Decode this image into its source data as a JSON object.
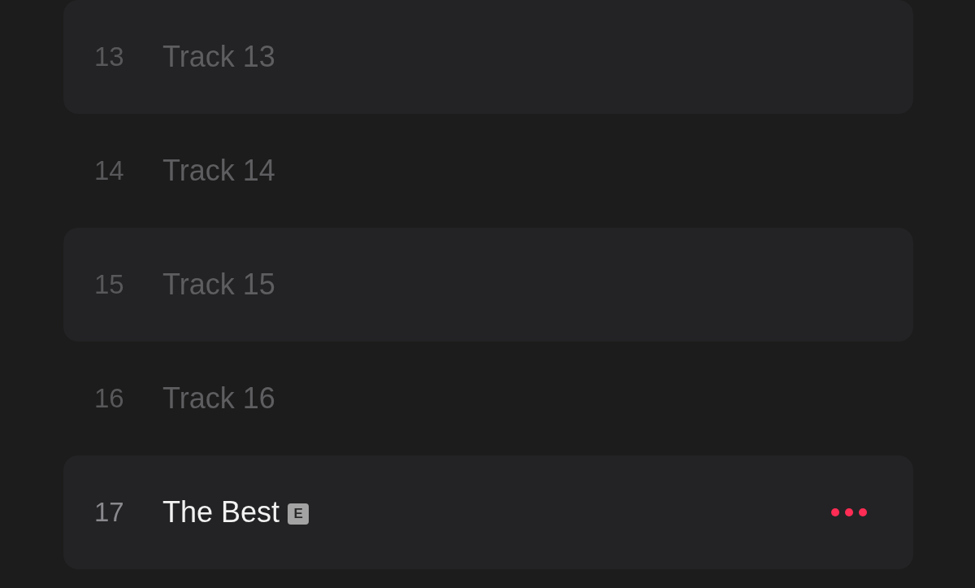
{
  "tracks": [
    {
      "number": "13",
      "title": "Track 13",
      "disabled": true
    },
    {
      "number": "14",
      "title": "Track 14",
      "disabled": true
    },
    {
      "number": "15",
      "title": "Track 15",
      "disabled": true
    },
    {
      "number": "16",
      "title": "Track 16",
      "disabled": true
    },
    {
      "number": "17",
      "title": "The Best",
      "badge": "E",
      "disabled": false
    }
  ]
}
